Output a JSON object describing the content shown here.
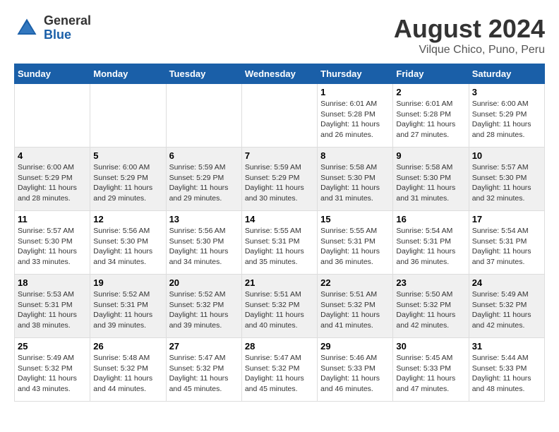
{
  "header": {
    "logo_general": "General",
    "logo_blue": "Blue",
    "main_title": "August 2024",
    "subtitle": "Vilque Chico, Puno, Peru"
  },
  "calendar": {
    "days_of_week": [
      "Sunday",
      "Monday",
      "Tuesday",
      "Wednesday",
      "Thursday",
      "Friday",
      "Saturday"
    ],
    "weeks": [
      [
        {
          "day": "",
          "info": ""
        },
        {
          "day": "",
          "info": ""
        },
        {
          "day": "",
          "info": ""
        },
        {
          "day": "",
          "info": ""
        },
        {
          "day": "1",
          "info": "Sunrise: 6:01 AM\nSunset: 5:28 PM\nDaylight: 11 hours\nand 26 minutes."
        },
        {
          "day": "2",
          "info": "Sunrise: 6:01 AM\nSunset: 5:28 PM\nDaylight: 11 hours\nand 27 minutes."
        },
        {
          "day": "3",
          "info": "Sunrise: 6:00 AM\nSunset: 5:29 PM\nDaylight: 11 hours\nand 28 minutes."
        }
      ],
      [
        {
          "day": "4",
          "info": "Sunrise: 6:00 AM\nSunset: 5:29 PM\nDaylight: 11 hours\nand 28 minutes."
        },
        {
          "day": "5",
          "info": "Sunrise: 6:00 AM\nSunset: 5:29 PM\nDaylight: 11 hours\nand 29 minutes."
        },
        {
          "day": "6",
          "info": "Sunrise: 5:59 AM\nSunset: 5:29 PM\nDaylight: 11 hours\nand 29 minutes."
        },
        {
          "day": "7",
          "info": "Sunrise: 5:59 AM\nSunset: 5:29 PM\nDaylight: 11 hours\nand 30 minutes."
        },
        {
          "day": "8",
          "info": "Sunrise: 5:58 AM\nSunset: 5:30 PM\nDaylight: 11 hours\nand 31 minutes."
        },
        {
          "day": "9",
          "info": "Sunrise: 5:58 AM\nSunset: 5:30 PM\nDaylight: 11 hours\nand 31 minutes."
        },
        {
          "day": "10",
          "info": "Sunrise: 5:57 AM\nSunset: 5:30 PM\nDaylight: 11 hours\nand 32 minutes."
        }
      ],
      [
        {
          "day": "11",
          "info": "Sunrise: 5:57 AM\nSunset: 5:30 PM\nDaylight: 11 hours\nand 33 minutes."
        },
        {
          "day": "12",
          "info": "Sunrise: 5:56 AM\nSunset: 5:30 PM\nDaylight: 11 hours\nand 34 minutes."
        },
        {
          "day": "13",
          "info": "Sunrise: 5:56 AM\nSunset: 5:30 PM\nDaylight: 11 hours\nand 34 minutes."
        },
        {
          "day": "14",
          "info": "Sunrise: 5:55 AM\nSunset: 5:31 PM\nDaylight: 11 hours\nand 35 minutes."
        },
        {
          "day": "15",
          "info": "Sunrise: 5:55 AM\nSunset: 5:31 PM\nDaylight: 11 hours\nand 36 minutes."
        },
        {
          "day": "16",
          "info": "Sunrise: 5:54 AM\nSunset: 5:31 PM\nDaylight: 11 hours\nand 36 minutes."
        },
        {
          "day": "17",
          "info": "Sunrise: 5:54 AM\nSunset: 5:31 PM\nDaylight: 11 hours\nand 37 minutes."
        }
      ],
      [
        {
          "day": "18",
          "info": "Sunrise: 5:53 AM\nSunset: 5:31 PM\nDaylight: 11 hours\nand 38 minutes."
        },
        {
          "day": "19",
          "info": "Sunrise: 5:52 AM\nSunset: 5:31 PM\nDaylight: 11 hours\nand 39 minutes."
        },
        {
          "day": "20",
          "info": "Sunrise: 5:52 AM\nSunset: 5:32 PM\nDaylight: 11 hours\nand 39 minutes."
        },
        {
          "day": "21",
          "info": "Sunrise: 5:51 AM\nSunset: 5:32 PM\nDaylight: 11 hours\nand 40 minutes."
        },
        {
          "day": "22",
          "info": "Sunrise: 5:51 AM\nSunset: 5:32 PM\nDaylight: 11 hours\nand 41 minutes."
        },
        {
          "day": "23",
          "info": "Sunrise: 5:50 AM\nSunset: 5:32 PM\nDaylight: 11 hours\nand 42 minutes."
        },
        {
          "day": "24",
          "info": "Sunrise: 5:49 AM\nSunset: 5:32 PM\nDaylight: 11 hours\nand 42 minutes."
        }
      ],
      [
        {
          "day": "25",
          "info": "Sunrise: 5:49 AM\nSunset: 5:32 PM\nDaylight: 11 hours\nand 43 minutes."
        },
        {
          "day": "26",
          "info": "Sunrise: 5:48 AM\nSunset: 5:32 PM\nDaylight: 11 hours\nand 44 minutes."
        },
        {
          "day": "27",
          "info": "Sunrise: 5:47 AM\nSunset: 5:32 PM\nDaylight: 11 hours\nand 45 minutes."
        },
        {
          "day": "28",
          "info": "Sunrise: 5:47 AM\nSunset: 5:32 PM\nDaylight: 11 hours\nand 45 minutes."
        },
        {
          "day": "29",
          "info": "Sunrise: 5:46 AM\nSunset: 5:33 PM\nDaylight: 11 hours\nand 46 minutes."
        },
        {
          "day": "30",
          "info": "Sunrise: 5:45 AM\nSunset: 5:33 PM\nDaylight: 11 hours\nand 47 minutes."
        },
        {
          "day": "31",
          "info": "Sunrise: 5:44 AM\nSunset: 5:33 PM\nDaylight: 11 hours\nand 48 minutes."
        }
      ]
    ]
  }
}
